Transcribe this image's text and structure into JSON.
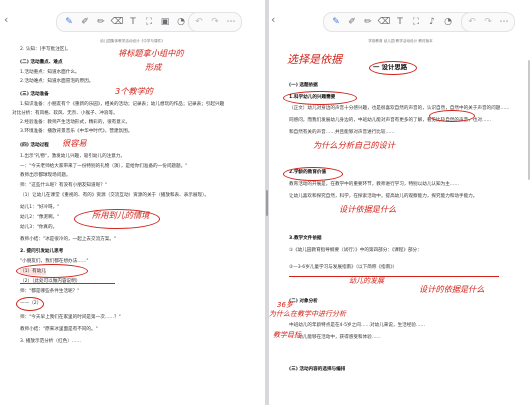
{
  "left": {
    "back_icon": "‹",
    "toolbar": {
      "tools": [
        "pen-icon",
        "pen-icon",
        "highlighter-icon",
        "eraser-icon",
        "text-tool-icon",
        "select-icon",
        "image-icon",
        "more-icon",
        "chevron-right-icon"
      ],
      "undo": "↶",
      "redo": "↷",
      "menu": "⋯"
    },
    "runhead": "幼儿园集体教学活动设计《中学与课件》",
    "lines": [
      "2. 认知：[手写批注区]。",
      "(二) 活动重点、难点",
      "1.活动重点：知道水面什么。",
      "2.活动难点：知道水面冒泡的原因。",
      "(三) 活动准备",
      "1.知识准备：小朋友有个《重新的乐园》，相关的活动；记录表；幼儿想玩的作品；记录表；引起兴趣",
      "对比分析：有风格、软风、无奈、小猴子、冲浪等。",
      "2.经验准备：教师产生活动形式，精彩的，很有意义。",
      "3.环境准备：播放背景音乐《中华中时代》，营建氛围。",
      "(四) 活动过程",
      "1.出示\"礼物\"，激发幼儿兴趣，吸引幼儿的注意力。",
      "一：\"今天老师给大家带来了一份特别的礼物（演），是给你们准备的一份问题题。\"",
      "教师出示都球现场问题。",
      "师：\"这些什么呢？有没有小朋友知道呢？\"",
      "（1）让幼儿在课堂《重视的、有的》资源（交流互动）资源的关于（播放和表、表示展现）。",
      "幼儿1：\"好冷呀。\"",
      "幼儿2：\"像泥啊。\"",
      "幼儿3：\"你真的。",
      "教师小结：\"冰是很冷的，一起上去交流方案。\"",
      "2. 提问引发幼儿思考",
      "\"小朋友们，我们都在想办法……\"",
      "（1）有幼儿",
      "（2）（此处可以做内容说明）",
      "师：\"都是哪些条件生活呢？\"",
      "——（2）",
      "师：\"今天早上我们在家里的时间是第一次……？\"",
      "教师小结：\"原来冰里面是有不同的。\"",
      "3. 播放示范分析（红色）……"
    ],
    "ink": [
      "将标题拿小组中的",
      "形成",
      "3个教学的",
      "很容易",
      "所用到儿的情境"
    ]
  },
  "right": {
    "back_icon": "‹",
    "toolbar": {
      "tools": [
        "pen-icon",
        "pen-icon",
        "highlighter-icon",
        "eraser-icon",
        "text-tool-icon",
        "select-icon",
        "mic-icon",
        "more-icon",
        "chevron-right-icon"
      ],
      "undo": "↶",
      "redo": "↷",
      "menu": "⋯"
    },
    "runhead": "学前教育 幼儿园 教学活动设计 教材版本",
    "section_title": "一 设计思路",
    "lines": [
      "(一) 选题依据",
      "1.科学幼儿的兴趣需要",
      "（正文）幼儿对身边的声音十分感兴趣，也是很喜欢自然的声音的，认识自然，自然中的关于声音的问题……",
      "同感问，而我们发展幼儿身边的，中班幼儿能对声音有更多的了解，看见比较自然的声音，也对……",
      "和自然有关的声音……并且能够对声音进行比较……",
      "2.学龄的教育价值",
      "教育活动的开展是，在教学中的重要环节，教师进行学习，特别以幼儿认知为主……",
      "让幼儿喜欢和探究自然，科学，在探索活动中，提高幼儿的观察能力，探究能力和动手能力。",
      "3.教学文件依据",
      "①《幼儿园教育指导纲要（试行）》中的第四部分：《课程》部分：",
      "②—3-6岁儿童学习与发展指南》（以下简称《指南》）",
      "(二) 对象分析",
      "中班幼儿的年龄特点是在4-5岁之间……对幼儿来说，生活经验……",
      "……幼儿能够在活动中，获得感受和体验……",
      "(三) 活动内容的选择与编排"
    ],
    "ink": [
      "选择是依据",
      "为什么分析自己的设计",
      "设计依据是什么",
      "设计的依据是什么",
      "幼儿的发展",
      "为什么在教学中进行分析",
      "36岁",
      "教学目标"
    ]
  }
}
